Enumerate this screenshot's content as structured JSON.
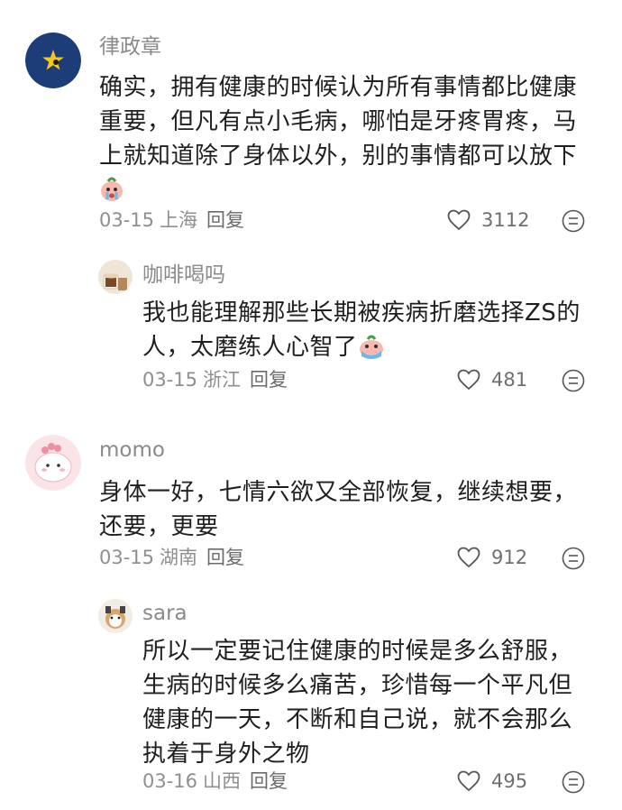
{
  "comments": [
    {
      "username": "律政章",
      "lines": [
        "确实，拥有健康的时候认为所有事情都比健康",
        "重要，但凡有点小毛病，哪怕是牙疼胃疼，马",
        "上就知道除了身体以外，别的事情都可以放下"
      ],
      "date": "03-15",
      "location": "上海",
      "reply_label": "回复",
      "likes": "3112"
    },
    {
      "username": "咖啡喝吗",
      "lines": [
        "我也能理解那些长期被疾病折磨选择ZS的",
        "人，太磨练人心智了"
      ],
      "date": "03-15",
      "location": "浙江",
      "reply_label": "回复",
      "likes": "481"
    },
    {
      "username": "momo",
      "lines": [
        "身体一好，七情六欲又全部恢复，继续想要，",
        "还要，更要"
      ],
      "date": "03-15",
      "location": "湖南",
      "reply_label": "回复",
      "likes": "912"
    },
    {
      "username": "sara",
      "lines": [
        "所以一定要记住健康的时候是多么舒服，",
        "生病的时候多么痛苦，珍惜每一个平凡但",
        "健康的一天，不断和自己说，就不会那么",
        "执着于身外之物"
      ],
      "date": "03-16",
      "location": "山西",
      "reply_label": "回复",
      "likes": "495"
    }
  ],
  "icons": {
    "like": "heart-outline-icon",
    "more": "comment-options-icon",
    "emoji": "crying-face-emoji"
  },
  "colors": {
    "username": "#8a8a8a",
    "body_text": "#1f1f1f",
    "meta": "#8f8f8f",
    "avatar_navy": "#1c3d78",
    "star": "#f2c81b"
  }
}
